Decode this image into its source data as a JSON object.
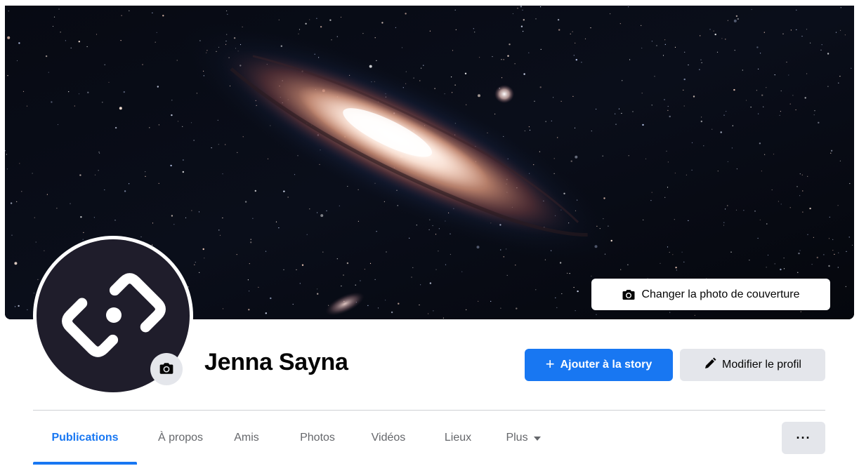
{
  "profile": {
    "name": "Jenna Sayna",
    "cover_button_label": "Changer la photo de couverture",
    "add_story_label": "Ajouter à la story",
    "add_story_plus": "+",
    "edit_profile_label": "Modifier le profil"
  },
  "tabs": [
    {
      "label": "Publications",
      "active": true
    },
    {
      "label": "À propos",
      "active": false
    },
    {
      "label": "Amis",
      "active": false
    },
    {
      "label": "Photos",
      "active": false
    },
    {
      "label": "Vidéos",
      "active": false
    },
    {
      "label": "Lieux",
      "active": false
    },
    {
      "label": "Plus",
      "active": false
    }
  ],
  "more_menu_label": "···",
  "icons": {
    "cover_camera": "camera-icon",
    "avatar_camera": "camera-icon",
    "edit": "pencil-icon",
    "plus_dropdown": "caret-down-icon",
    "avatar_logo": "brand-logo-icon"
  },
  "colors": {
    "accent": "#1877f2",
    "secondary_button": "#e4e6eb",
    "tab_inactive": "#65676b",
    "avatar_bg": "#1f1d2b"
  }
}
